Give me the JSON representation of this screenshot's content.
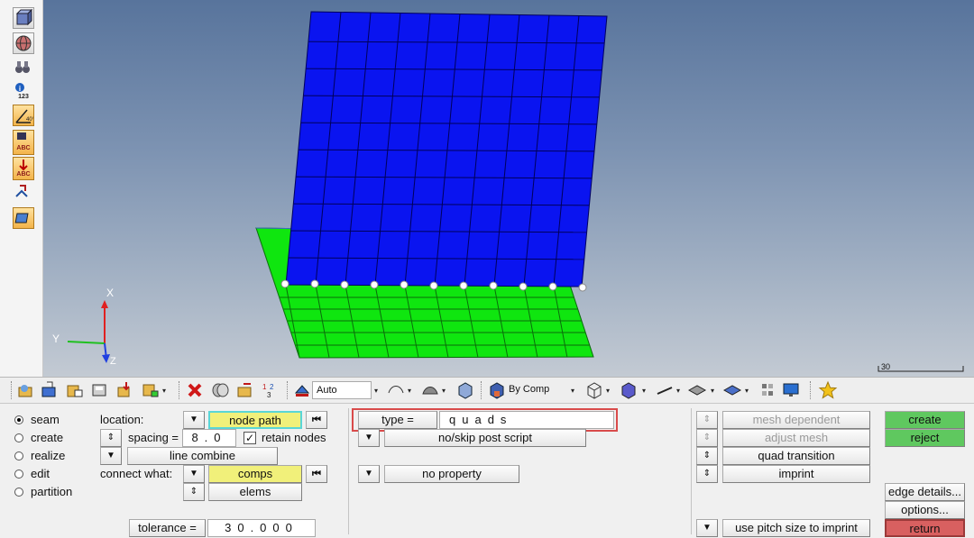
{
  "left_toolbar": {
    "info_label": "123",
    "abc_label_1": "ABC",
    "abc_label_2": "ABC"
  },
  "viewport": {
    "axis_x": "X",
    "axis_y": "Y",
    "axis_z": "Z",
    "scale_label": "30"
  },
  "toolbar": {
    "auto_combo": "Auto",
    "comp_combo": "By Comp"
  },
  "panel": {
    "modes": [
      {
        "label": "seam",
        "selected": true
      },
      {
        "label": "create",
        "selected": false
      },
      {
        "label": "realize",
        "selected": false
      },
      {
        "label": "edit",
        "selected": false
      },
      {
        "label": "partition",
        "selected": false
      }
    ],
    "location_label": "location:",
    "location_value": "node path",
    "spacing_label": "spacing =",
    "spacing_value": "8.0",
    "retain_nodes_label": "retain nodes",
    "retain_nodes_checked": "✓",
    "line_combine": "line combine",
    "connect_what_label": "connect what:",
    "connect_comps": "comps",
    "connect_elems": "elems",
    "tolerance_label": "tolerance =",
    "tolerance_value": "30.000",
    "type_label": "type =",
    "type_value": "quads",
    "post_script": "no/skip post script",
    "property": "no property",
    "mesh_dependent": "mesh dependent",
    "adjust_mesh": "adjust mesh",
    "quad_transition": "quad transition",
    "imprint": "imprint",
    "pitch_imprint": "use pitch size to imprint",
    "create": "create",
    "reject": "reject",
    "edge_details": "edge details...",
    "options": "options...",
    "return": "return"
  }
}
